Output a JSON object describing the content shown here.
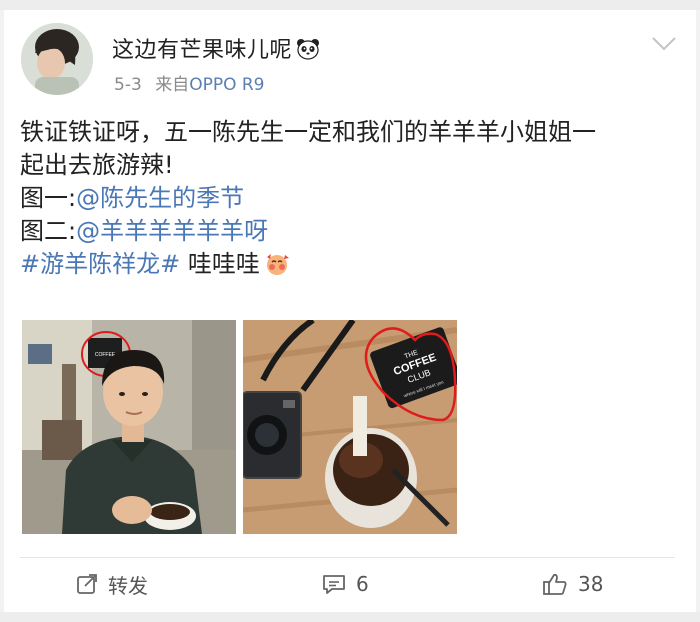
{
  "post": {
    "username": "这边有芒果味儿呢",
    "date": "5-3",
    "source_prefix": "来自",
    "source": "OPPO R9",
    "text_lines": [
      "铁证铁证呀，五一陈先生一定和我们的羊羊羊小姐姐一",
      "起出去旅游辣!"
    ],
    "pic1_label": "图一:",
    "pic1_mention": "@陈先生的季节",
    "pic2_label": "图二:",
    "pic2_mention": "@羊羊羊羊羊羊呀",
    "hashtag": "#游羊陈祥龙#",
    "hashtag_after": " 哇哇哇"
  },
  "images": {
    "coffee_sign_text": [
      "THE",
      "COFFEE",
      "CLUB",
      "where will I meet you"
    ]
  },
  "actions": {
    "repost_label": "转发",
    "comment_count": "6",
    "like_count": "38"
  },
  "icons": [
    "panda-emoji-icon",
    "chevron-down-icon",
    "shy-emoji-icon",
    "repost-icon",
    "comment-icon",
    "thumbs-up-icon"
  ]
}
